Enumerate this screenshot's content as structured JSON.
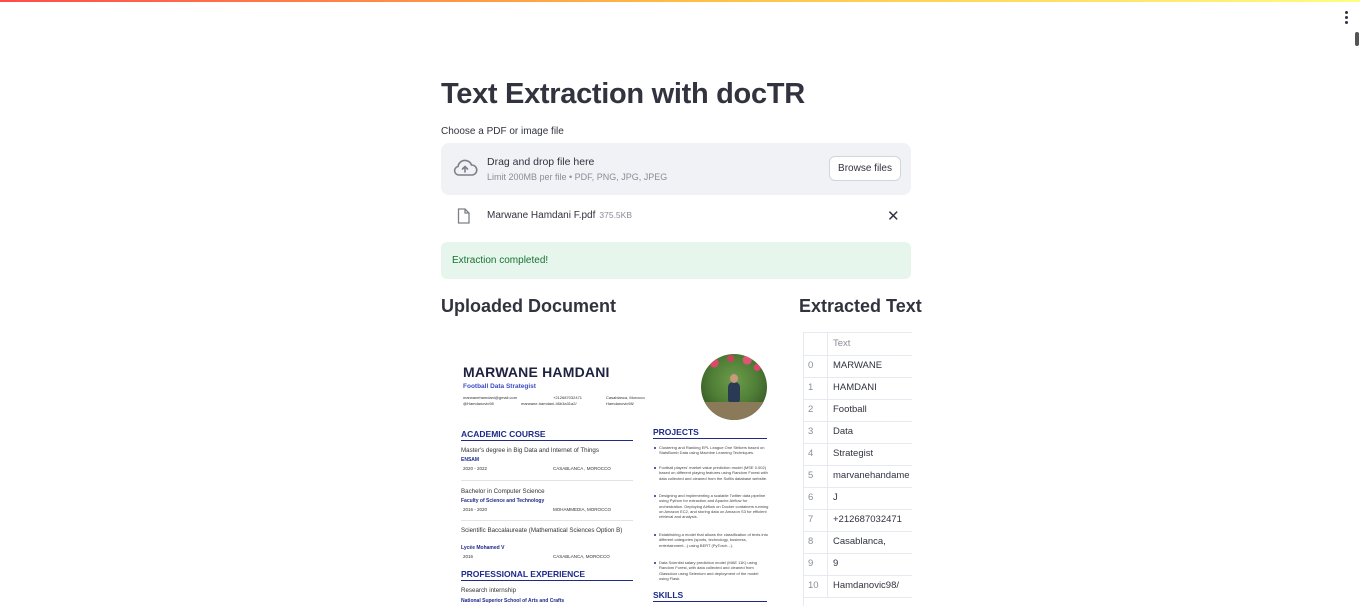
{
  "app": {
    "title": "Text Extraction with docTR",
    "accent_color": "#ff4b4b"
  },
  "uploader": {
    "label": "Choose a PDF or image file",
    "drop_text": "Drag and drop file here",
    "limit_text": "Limit 200MB per file • PDF, PNG, JPG, JPEG",
    "browse_label": "Browse files",
    "icon": "cloud-upload-icon"
  },
  "file": {
    "name": "Marwane Hamdani F.pdf",
    "size": "375.5KB",
    "icon": "file-icon",
    "remove_icon": "close-icon",
    "remove_glyph": "✕"
  },
  "status": {
    "message": "Extraction completed!",
    "color": "#177233"
  },
  "sections": {
    "uploaded_title": "Uploaded Document",
    "extracted_title": "Extracted Text"
  },
  "document": {
    "name": "MARWANE HAMDANI",
    "role": "Football Data Strategist",
    "contacts": {
      "email": "marwanehamdani@gmail.com",
      "phone": "+212687032471",
      "city": "Casablanca, Morocco",
      "twitter": "@Hamdanovic98",
      "linkedin": "marwane-hamdani-46b3a31a2/",
      "github": "Hamdanovic98/"
    },
    "academic_title": "ACADEMIC COURSE",
    "academic": [
      {
        "degree": "Master's degree in Big Data and Internet of Things",
        "school": "ENSAM",
        "dates": "2020 - 2022",
        "place": "CASABLANCA , MOROCCO"
      },
      {
        "degree": "Bachelor in Computer Science",
        "school": "Faculty of Science and Technology",
        "dates": "2016 - 2020",
        "place": "MOHAMMEDIA, MOROCCO"
      },
      {
        "degree": "Scientific Baccalaureate (Mathematical Sciences Option B)",
        "school": "Lycée Mohamed V",
        "dates": "2016",
        "place": "CASABLANCA, MOROCCO"
      }
    ],
    "experience_title": "PROFESSIONAL EXPERIENCE",
    "experience": [
      {
        "role": "Research internship",
        "org": "National Superior School of Arts and Crafts"
      }
    ],
    "projects_title": "PROJECTS",
    "projects": [
      "Clustering and Ranking EPL League One Strikers based on StatsBomb Data using Machine Learning Techniques.",
      "Football players' market value prediction model (MSE 0.002) based on different playing features using Random Forest with data collected and cleaned from the Sofifa database website.",
      "Designing and implementing a scalable Twitter data pipeline using Python for extraction and Apache Airflow for orchestration. Deploying Airflow on Docker containers running on Amazon EC2, and storing data on Amazon S3 for efficient retrieval and analysis.",
      "Establishing a model that allows the classification of texts into different categories (sports, technology, business, entertainment...) using BERT (PyTorch...).",
      "Data Scientist salary prediction model (MAE 11K) using Random Forest, with data collected and cleaned from Glassdoor using Selenium and deployment of the model using Flask."
    ],
    "skills_title": "SKILLS"
  },
  "table": {
    "header": "Text",
    "rows": [
      {
        "index": "0",
        "text": "MARWANE"
      },
      {
        "index": "1",
        "text": "HAMDANI"
      },
      {
        "index": "2",
        "text": "Football"
      },
      {
        "index": "3",
        "text": "Data"
      },
      {
        "index": "4",
        "text": "Strategist"
      },
      {
        "index": "5",
        "text": "marvanehandame"
      },
      {
        "index": "6",
        "text": "J"
      },
      {
        "index": "7",
        "text": "+212687032471"
      },
      {
        "index": "8",
        "text": "Casablanca,"
      },
      {
        "index": "9",
        "text": "9"
      },
      {
        "index": "10",
        "text": "Hamdanovic98/"
      }
    ]
  }
}
